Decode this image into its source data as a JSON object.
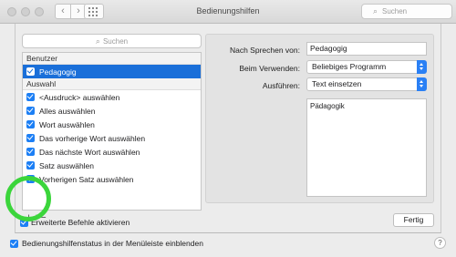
{
  "window": {
    "title": "Bedienungshilfen",
    "search_placeholder": "Suchen"
  },
  "sheet": {
    "list_search_placeholder": "Suchen",
    "list": {
      "section_user": "Benutzer",
      "user_items": [
        {
          "label": "Pedagogig",
          "checked": true,
          "selected": true
        }
      ],
      "section_selection": "Auswahl",
      "selection_items": [
        {
          "label": "<Ausdruck> auswählen",
          "checked": true
        },
        {
          "label": "Alles auswählen",
          "checked": true
        },
        {
          "label": "Wort auswählen",
          "checked": true
        },
        {
          "label": "Das vorherige Wort auswählen",
          "checked": true
        },
        {
          "label": "Das nächste Wort auswählen",
          "checked": true
        },
        {
          "label": "Satz auswählen",
          "checked": true
        },
        {
          "label": "Vorherigen Satz auswählen",
          "checked": true
        }
      ]
    },
    "add_label": "+",
    "remove_label": "−",
    "detail": {
      "when_speaking_label": "Nach Sprechen von:",
      "when_speaking_value": "Pedagogig",
      "while_using_label": "Beim Verwenden:",
      "while_using_value": "Beliebiges Programm",
      "perform_label": "Ausführen:",
      "perform_value": "Text einsetzen",
      "text_value": "Pädagogik"
    },
    "advanced_label": "Erweiterte Befehle aktivieren",
    "done_label": "Fertig"
  },
  "footer": {
    "menubar_status_label": "Bedienungshilfenstatus in der Menüleiste einblenden",
    "help_label": "?"
  },
  "colors": {
    "accent": "#1c7ff5",
    "selection": "#1a6fd9",
    "highlight_ring": "#3bd53b"
  }
}
